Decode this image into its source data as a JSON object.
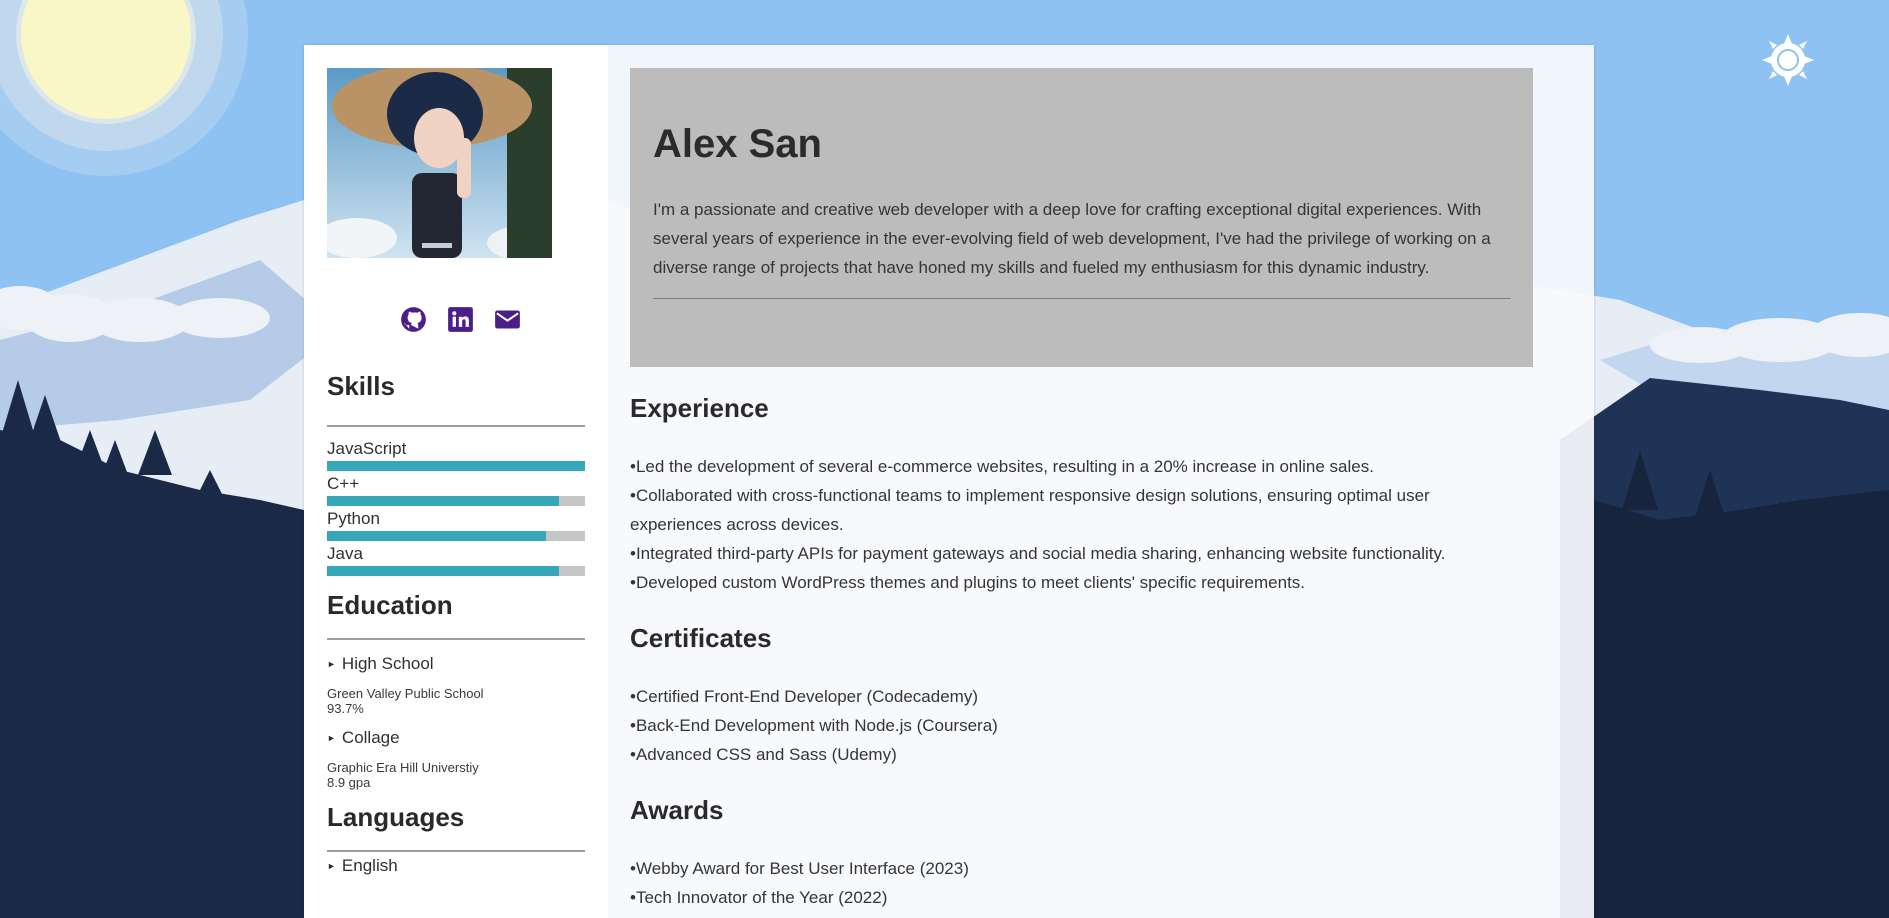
{
  "profile": {
    "name": "Alex San",
    "intro": "I'm a passionate and creative web developer with a deep love for crafting exceptional digital experiences. With several years of experience in the ever-evolving field of web development, I've had the privilege of working on a diverse range of projects that have honed my skills and fueled my enthusiasm for this dynamic industry.",
    "avatar_icon": "profile-photo"
  },
  "social": {
    "github_icon": "github-icon",
    "linkedin_icon": "linkedin-icon",
    "email_icon": "envelope-icon",
    "color": "#4a1f8a"
  },
  "skills": {
    "title": "Skills",
    "items": [
      {
        "name": "JavaScript",
        "level": 1.0
      },
      {
        "name": "C++",
        "level": 0.9
      },
      {
        "name": "Python",
        "level": 0.85
      },
      {
        "name": "Java",
        "level": 0.9
      }
    ],
    "bar_color": "#35a7b9"
  },
  "education": {
    "title": "Education",
    "items": [
      {
        "label": "High School",
        "school": "Green Valley Public School",
        "score": "93.7%"
      },
      {
        "label": "Collage",
        "school": "Graphic Era Hill Universtiy",
        "score": "8.9 gpa"
      }
    ]
  },
  "languages": {
    "title": "Languages",
    "items": [
      {
        "label": "English"
      }
    ]
  },
  "experience": {
    "title": "Experience",
    "items": [
      "Led the development of several e-commerce websites, resulting in a 20% increase in online sales.",
      "Collaborated with cross-functional teams to implement responsive design solutions, ensuring optimal user experiences across devices.",
      "Integrated third-party APIs for payment gateways and social media sharing, enhancing website functionality.",
      "Developed custom WordPress themes and plugins to meet clients' specific requirements."
    ]
  },
  "certificates": {
    "title": "Certificates",
    "items": [
      "Certified Front-End Developer (Codecademy)",
      "Back-End Development with Node.js (Coursera)",
      "Advanced CSS and Sass (Udemy)"
    ]
  },
  "awards": {
    "title": "Awards",
    "items": [
      "Webby Award for Best User Interface (2023)",
      "Tech Innovator of the Year (2022)"
    ]
  },
  "theme_toggle": {
    "icon": "sun-icon"
  }
}
